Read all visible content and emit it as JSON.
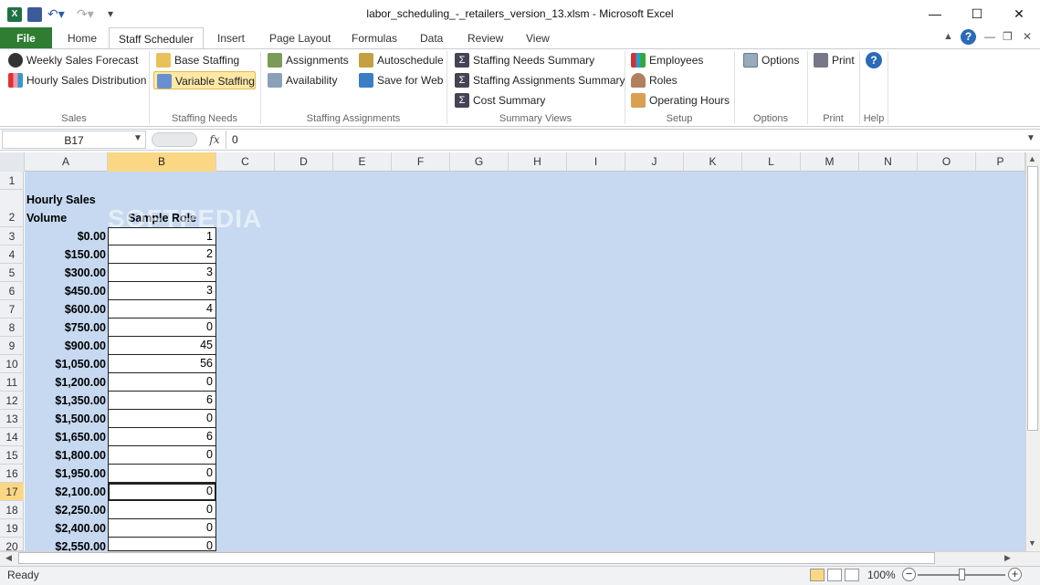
{
  "window": {
    "title": "labor_scheduling_-_retailers_version_13.xlsm  -  Microsoft Excel",
    "minimize": "—",
    "maximize": "☐",
    "close": "✕"
  },
  "tabs": [
    "File",
    "Home",
    "Staff Scheduler",
    "Insert",
    "Page Layout",
    "Formulas",
    "Data",
    "Review",
    "View"
  ],
  "active_tab": "Staff Scheduler",
  "ribbon": {
    "groups": [
      {
        "label": "Sales",
        "items": [
          "Weekly Sales Forecast",
          "Hourly Sales Distribution"
        ]
      },
      {
        "label": "Staffing Needs",
        "items": [
          "Base Staffing",
          "Variable Staffing"
        ]
      },
      {
        "label": "Staffing Assignments",
        "items": [
          "Assignments",
          "Availability",
          "Autoschedule",
          "Save for Web"
        ]
      },
      {
        "label": "Summary Views",
        "items": [
          "Staffing Needs Summary",
          "Staffing Assignments Summary",
          "Cost Summary"
        ]
      },
      {
        "label": "Setup",
        "items": [
          "Employees",
          "Roles",
          "Operating Hours"
        ]
      },
      {
        "label": "Options",
        "items": [
          "Options"
        ]
      },
      {
        "label": "Print",
        "items": [
          "Print"
        ]
      },
      {
        "label": "Help",
        "items": [
          "?"
        ]
      }
    ],
    "selected_item": "Variable Staffing"
  },
  "formula_bar": {
    "name_box": "B17",
    "fx": "fx",
    "value": "0"
  },
  "columns": [
    "A",
    "B",
    "C",
    "D",
    "E",
    "F",
    "G",
    "H",
    "I",
    "J",
    "K",
    "L",
    "M",
    "N",
    "O",
    "P"
  ],
  "selected_column": "B",
  "rows": [
    "1",
    "2",
    "3",
    "4",
    "5",
    "6",
    "7",
    "8",
    "9",
    "10",
    "11",
    "12",
    "13",
    "14",
    "15",
    "16",
    "17",
    "18",
    "19",
    "20"
  ],
  "selected_row": "17",
  "sheet": {
    "header_a_line1": "Hourly Sales",
    "header_a_line2": "Volume",
    "header_b": "Sample Role",
    "volumes": [
      "$0.00",
      "$150.00",
      "$300.00",
      "$450.00",
      "$600.00",
      "$750.00",
      "$900.00",
      "$1,050.00",
      "$1,200.00",
      "$1,350.00",
      "$1,500.00",
      "$1,650.00",
      "$1,800.00",
      "$1,950.00",
      "$2,100.00",
      "$2,250.00",
      "$2,400.00",
      "$2,550.00"
    ],
    "staff": [
      "1",
      "2",
      "3",
      "3",
      "4",
      "0",
      "45",
      "56",
      "0",
      "6",
      "0",
      "6",
      "0",
      "0",
      "0",
      "0",
      "0",
      "0"
    ]
  },
  "status": {
    "ready": "Ready",
    "zoom": "100%"
  },
  "watermark": "SOFTPEDIA",
  "colors": {
    "file_tab": "#2e7d32",
    "selection": "#fbd784",
    "sheet_bg": "#c6d9f0"
  }
}
